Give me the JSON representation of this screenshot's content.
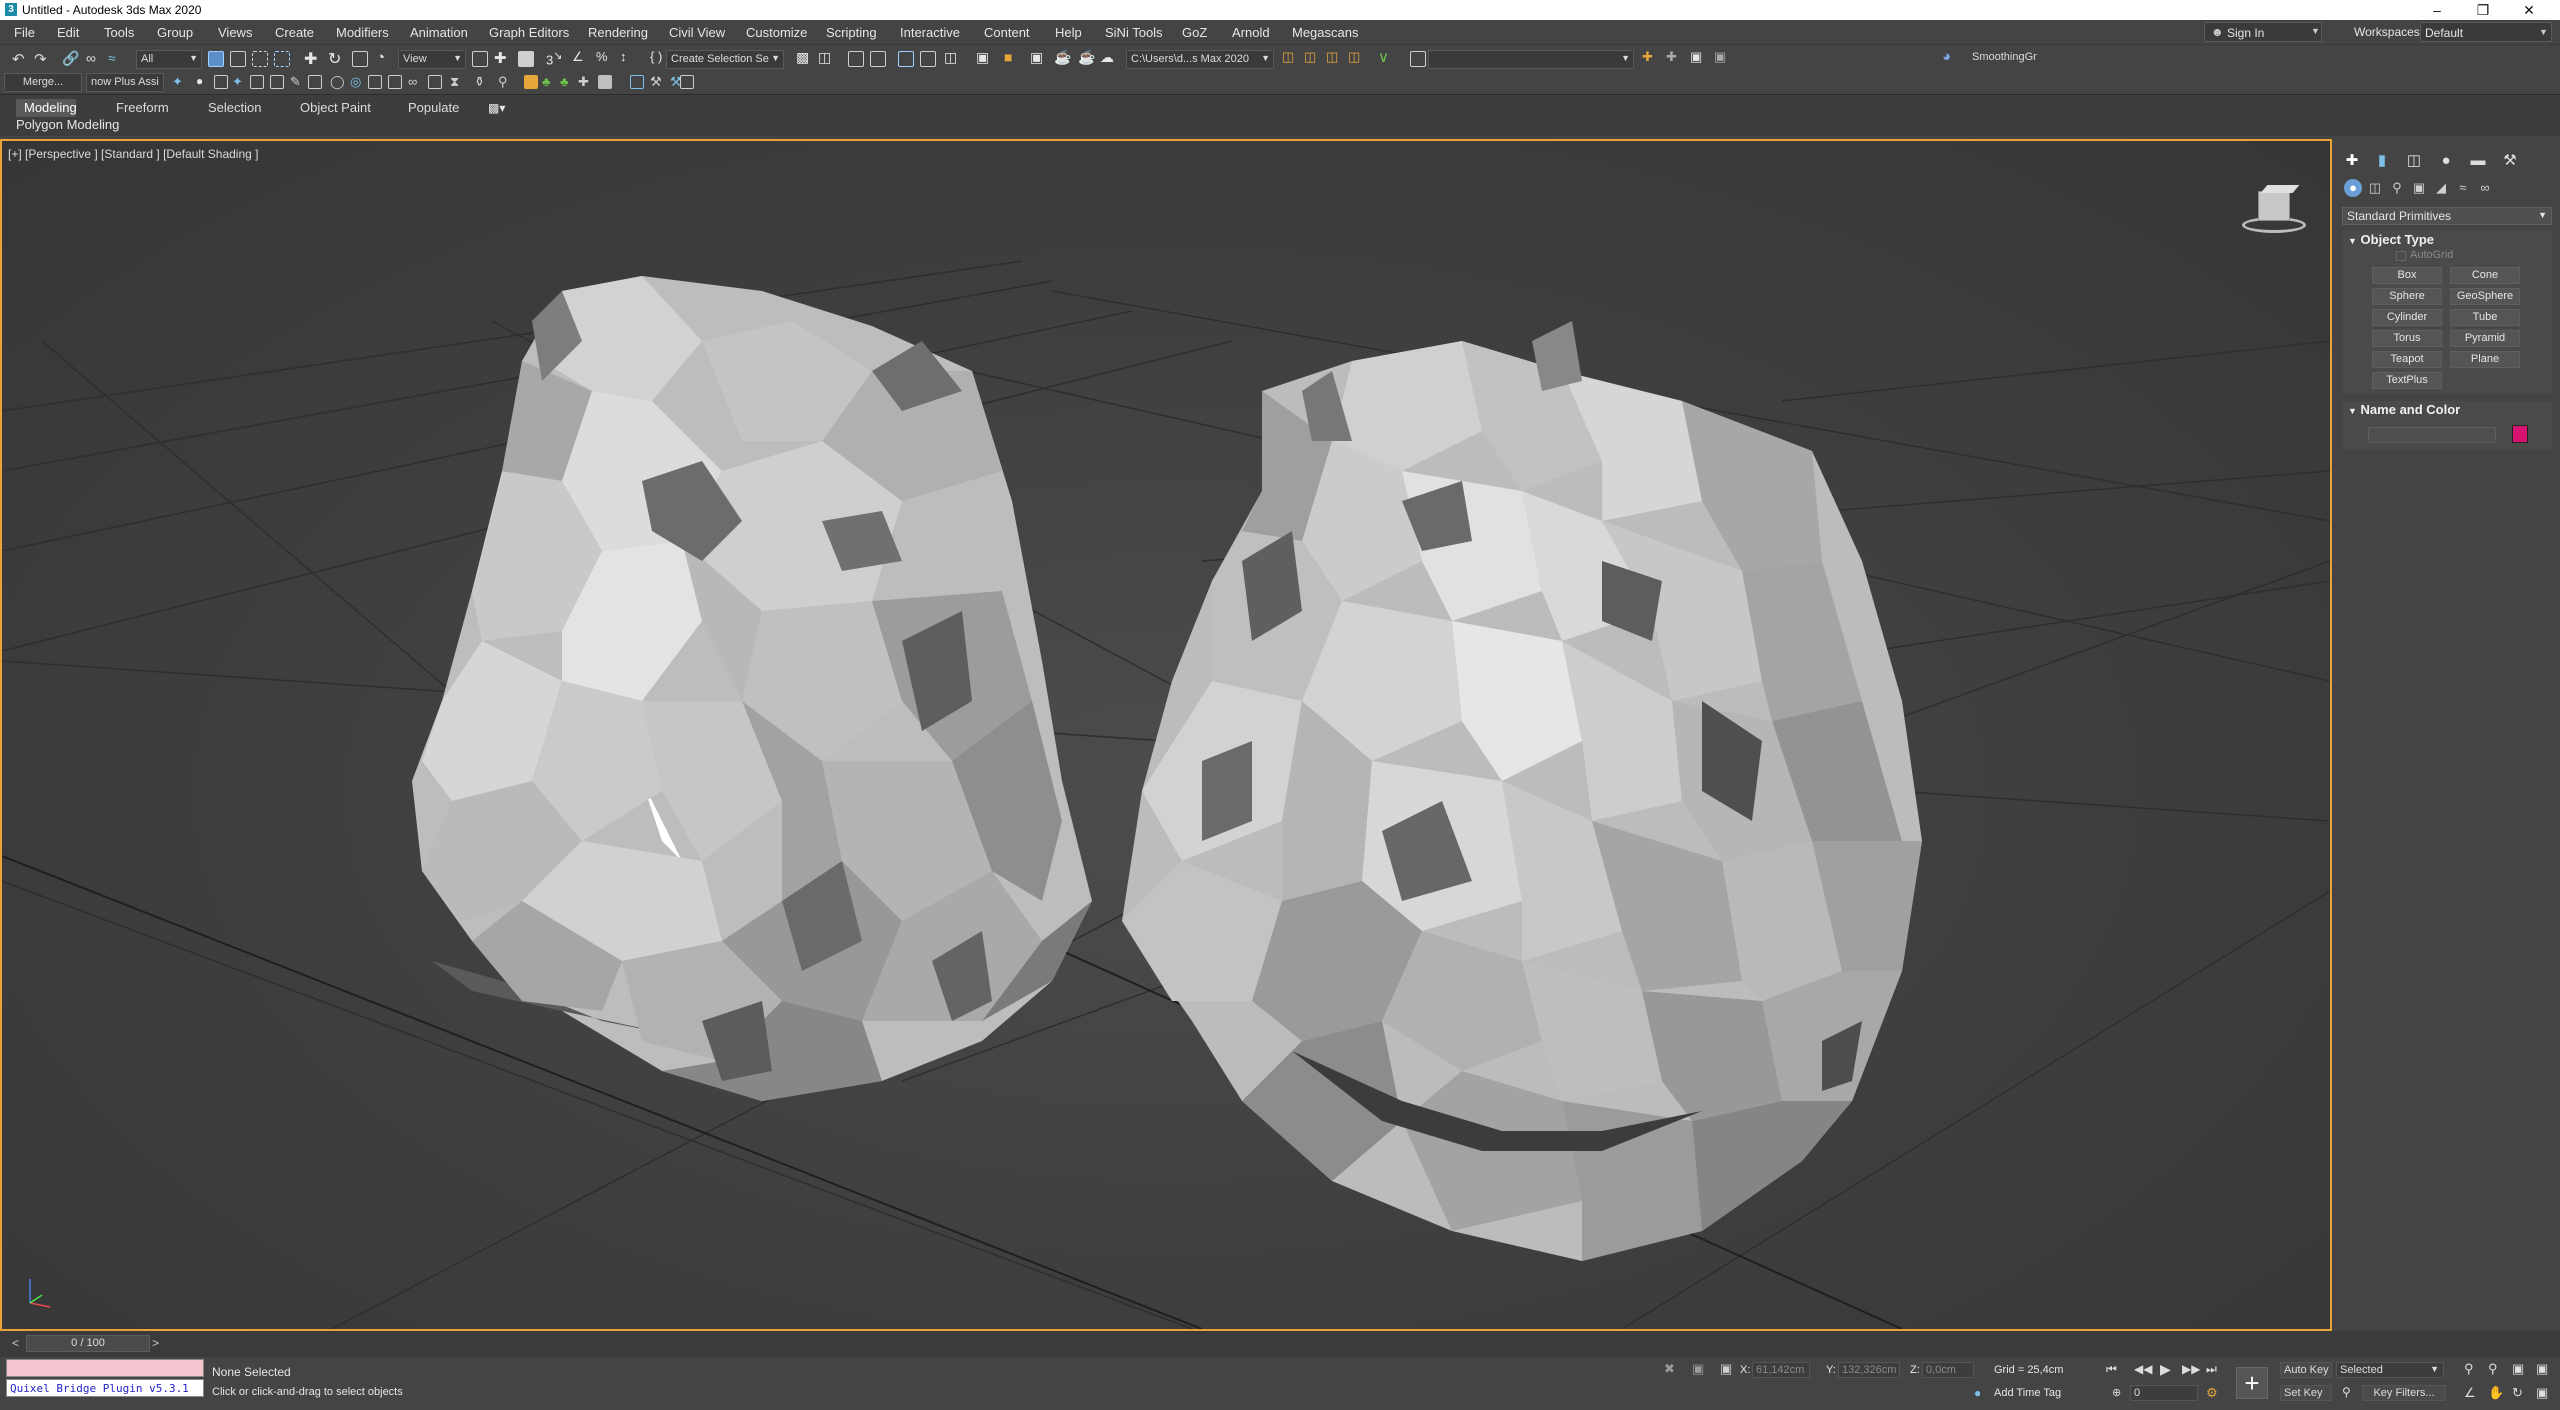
{
  "window": {
    "title": "Untitled - Autodesk 3ds Max 2020",
    "controls": [
      "–",
      "❐",
      "✕"
    ]
  },
  "menubar": {
    "items": [
      "File",
      "Edit",
      "Tools",
      "Group",
      "Views",
      "Create",
      "Modifiers",
      "Animation",
      "Graph Editors",
      "Rendering",
      "Civil View",
      "Customize",
      "Scripting",
      "Interactive",
      "Content",
      "Help",
      "SiNi Tools",
      "GoZ",
      "Arnold",
      "Megascans"
    ],
    "sign_in": "Sign In",
    "workspaces_label": "Workspaces:",
    "workspaces_value": "Default"
  },
  "toolbar1": {
    "selection_filter": "All",
    "ref_coord": "View",
    "named_selection": "Create Selection Se",
    "project_path": "C:\\Users\\d...s Max 2020",
    "smoothing": "SmoothingGr"
  },
  "toolbar2": {
    "merge": "Merge...",
    "plugin": "now Plus Assi"
  },
  "ribbon": {
    "tabs": [
      "Modeling",
      "Freeform",
      "Selection",
      "Object Paint",
      "Populate"
    ],
    "active_tab": "Modeling",
    "sub_label": "Polygon Modeling"
  },
  "viewport": {
    "label": "[+] [Perspective ] [Standard ] [Default Shading ]"
  },
  "command_panel": {
    "category": "Standard Primitives",
    "object_type_title": "Object Type",
    "autogrid": "AutoGrid",
    "buttons": [
      "Box",
      "Cone",
      "Sphere",
      "GeoSphere",
      "Cylinder",
      "Tube",
      "Torus",
      "Pyramid",
      "Teapot",
      "Plane",
      "TextPlus"
    ],
    "name_color_title": "Name and Color",
    "object_color": "#d4146e"
  },
  "timeline": {
    "frame": "0 / 100"
  },
  "status": {
    "script_listener": "Quixel Bridge Plugin v5.3.1",
    "selection": "None Selected",
    "prompt": "Click or click-and-drag to select objects",
    "x_label": "X:",
    "x_value": "61,142cm",
    "y_label": "Y:",
    "y_value": "132,326cm",
    "z_label": "Z:",
    "z_value": "0,0cm",
    "grid": "Grid = 25,4cm",
    "add_time_tag": "Add Time Tag",
    "auto_key": "Auto Key",
    "set_key": "Set Key",
    "key_mode": "Selected",
    "key_filters": "Key Filters...",
    "current_frame": "0"
  },
  "colors": {
    "viewport_border": "#e9a334",
    "script_listener_bg": "#f3c6cf",
    "script_listener_text": "#2424c8"
  }
}
